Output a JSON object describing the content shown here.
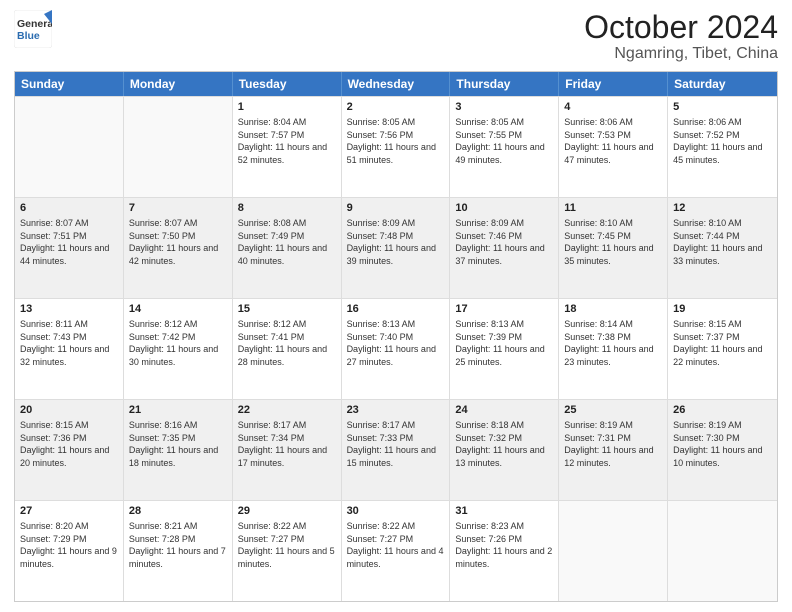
{
  "header": {
    "logo_general": "General",
    "logo_blue": "Blue",
    "main_title": "October 2024",
    "sub_title": "Ngamring, Tibet, China"
  },
  "calendar": {
    "days_of_week": [
      "Sunday",
      "Monday",
      "Tuesday",
      "Wednesday",
      "Thursday",
      "Friday",
      "Saturday"
    ],
    "rows": [
      [
        {
          "day": "",
          "detail": "",
          "empty": true
        },
        {
          "day": "",
          "detail": "",
          "empty": true
        },
        {
          "day": "1",
          "detail": "Sunrise: 8:04 AM\nSunset: 7:57 PM\nDaylight: 11 hours and 52 minutes."
        },
        {
          "day": "2",
          "detail": "Sunrise: 8:05 AM\nSunset: 7:56 PM\nDaylight: 11 hours and 51 minutes."
        },
        {
          "day": "3",
          "detail": "Sunrise: 8:05 AM\nSunset: 7:55 PM\nDaylight: 11 hours and 49 minutes."
        },
        {
          "day": "4",
          "detail": "Sunrise: 8:06 AM\nSunset: 7:53 PM\nDaylight: 11 hours and 47 minutes."
        },
        {
          "day": "5",
          "detail": "Sunrise: 8:06 AM\nSunset: 7:52 PM\nDaylight: 11 hours and 45 minutes."
        }
      ],
      [
        {
          "day": "6",
          "detail": "Sunrise: 8:07 AM\nSunset: 7:51 PM\nDaylight: 11 hours and 44 minutes.",
          "shaded": true
        },
        {
          "day": "7",
          "detail": "Sunrise: 8:07 AM\nSunset: 7:50 PM\nDaylight: 11 hours and 42 minutes.",
          "shaded": true
        },
        {
          "day": "8",
          "detail": "Sunrise: 8:08 AM\nSunset: 7:49 PM\nDaylight: 11 hours and 40 minutes.",
          "shaded": true
        },
        {
          "day": "9",
          "detail": "Sunrise: 8:09 AM\nSunset: 7:48 PM\nDaylight: 11 hours and 39 minutes.",
          "shaded": true
        },
        {
          "day": "10",
          "detail": "Sunrise: 8:09 AM\nSunset: 7:46 PM\nDaylight: 11 hours and 37 minutes.",
          "shaded": true
        },
        {
          "day": "11",
          "detail": "Sunrise: 8:10 AM\nSunset: 7:45 PM\nDaylight: 11 hours and 35 minutes.",
          "shaded": true
        },
        {
          "day": "12",
          "detail": "Sunrise: 8:10 AM\nSunset: 7:44 PM\nDaylight: 11 hours and 33 minutes.",
          "shaded": true
        }
      ],
      [
        {
          "day": "13",
          "detail": "Sunrise: 8:11 AM\nSunset: 7:43 PM\nDaylight: 11 hours and 32 minutes."
        },
        {
          "day": "14",
          "detail": "Sunrise: 8:12 AM\nSunset: 7:42 PM\nDaylight: 11 hours and 30 minutes."
        },
        {
          "day": "15",
          "detail": "Sunrise: 8:12 AM\nSunset: 7:41 PM\nDaylight: 11 hours and 28 minutes."
        },
        {
          "day": "16",
          "detail": "Sunrise: 8:13 AM\nSunset: 7:40 PM\nDaylight: 11 hours and 27 minutes."
        },
        {
          "day": "17",
          "detail": "Sunrise: 8:13 AM\nSunset: 7:39 PM\nDaylight: 11 hours and 25 minutes."
        },
        {
          "day": "18",
          "detail": "Sunrise: 8:14 AM\nSunset: 7:38 PM\nDaylight: 11 hours and 23 minutes."
        },
        {
          "day": "19",
          "detail": "Sunrise: 8:15 AM\nSunset: 7:37 PM\nDaylight: 11 hours and 22 minutes."
        }
      ],
      [
        {
          "day": "20",
          "detail": "Sunrise: 8:15 AM\nSunset: 7:36 PM\nDaylight: 11 hours and 20 minutes.",
          "shaded": true
        },
        {
          "day": "21",
          "detail": "Sunrise: 8:16 AM\nSunset: 7:35 PM\nDaylight: 11 hours and 18 minutes.",
          "shaded": true
        },
        {
          "day": "22",
          "detail": "Sunrise: 8:17 AM\nSunset: 7:34 PM\nDaylight: 11 hours and 17 minutes.",
          "shaded": true
        },
        {
          "day": "23",
          "detail": "Sunrise: 8:17 AM\nSunset: 7:33 PM\nDaylight: 11 hours and 15 minutes.",
          "shaded": true
        },
        {
          "day": "24",
          "detail": "Sunrise: 8:18 AM\nSunset: 7:32 PM\nDaylight: 11 hours and 13 minutes.",
          "shaded": true
        },
        {
          "day": "25",
          "detail": "Sunrise: 8:19 AM\nSunset: 7:31 PM\nDaylight: 11 hours and 12 minutes.",
          "shaded": true
        },
        {
          "day": "26",
          "detail": "Sunrise: 8:19 AM\nSunset: 7:30 PM\nDaylight: 11 hours and 10 minutes.",
          "shaded": true
        }
      ],
      [
        {
          "day": "27",
          "detail": "Sunrise: 8:20 AM\nSunset: 7:29 PM\nDaylight: 11 hours and 9 minutes."
        },
        {
          "day": "28",
          "detail": "Sunrise: 8:21 AM\nSunset: 7:28 PM\nDaylight: 11 hours and 7 minutes."
        },
        {
          "day": "29",
          "detail": "Sunrise: 8:22 AM\nSunset: 7:27 PM\nDaylight: 11 hours and 5 minutes."
        },
        {
          "day": "30",
          "detail": "Sunrise: 8:22 AM\nSunset: 7:27 PM\nDaylight: 11 hours and 4 minutes."
        },
        {
          "day": "31",
          "detail": "Sunrise: 8:23 AM\nSunset: 7:26 PM\nDaylight: 11 hours and 2 minutes."
        },
        {
          "day": "",
          "detail": "",
          "empty": true
        },
        {
          "day": "",
          "detail": "",
          "empty": true
        }
      ]
    ]
  }
}
